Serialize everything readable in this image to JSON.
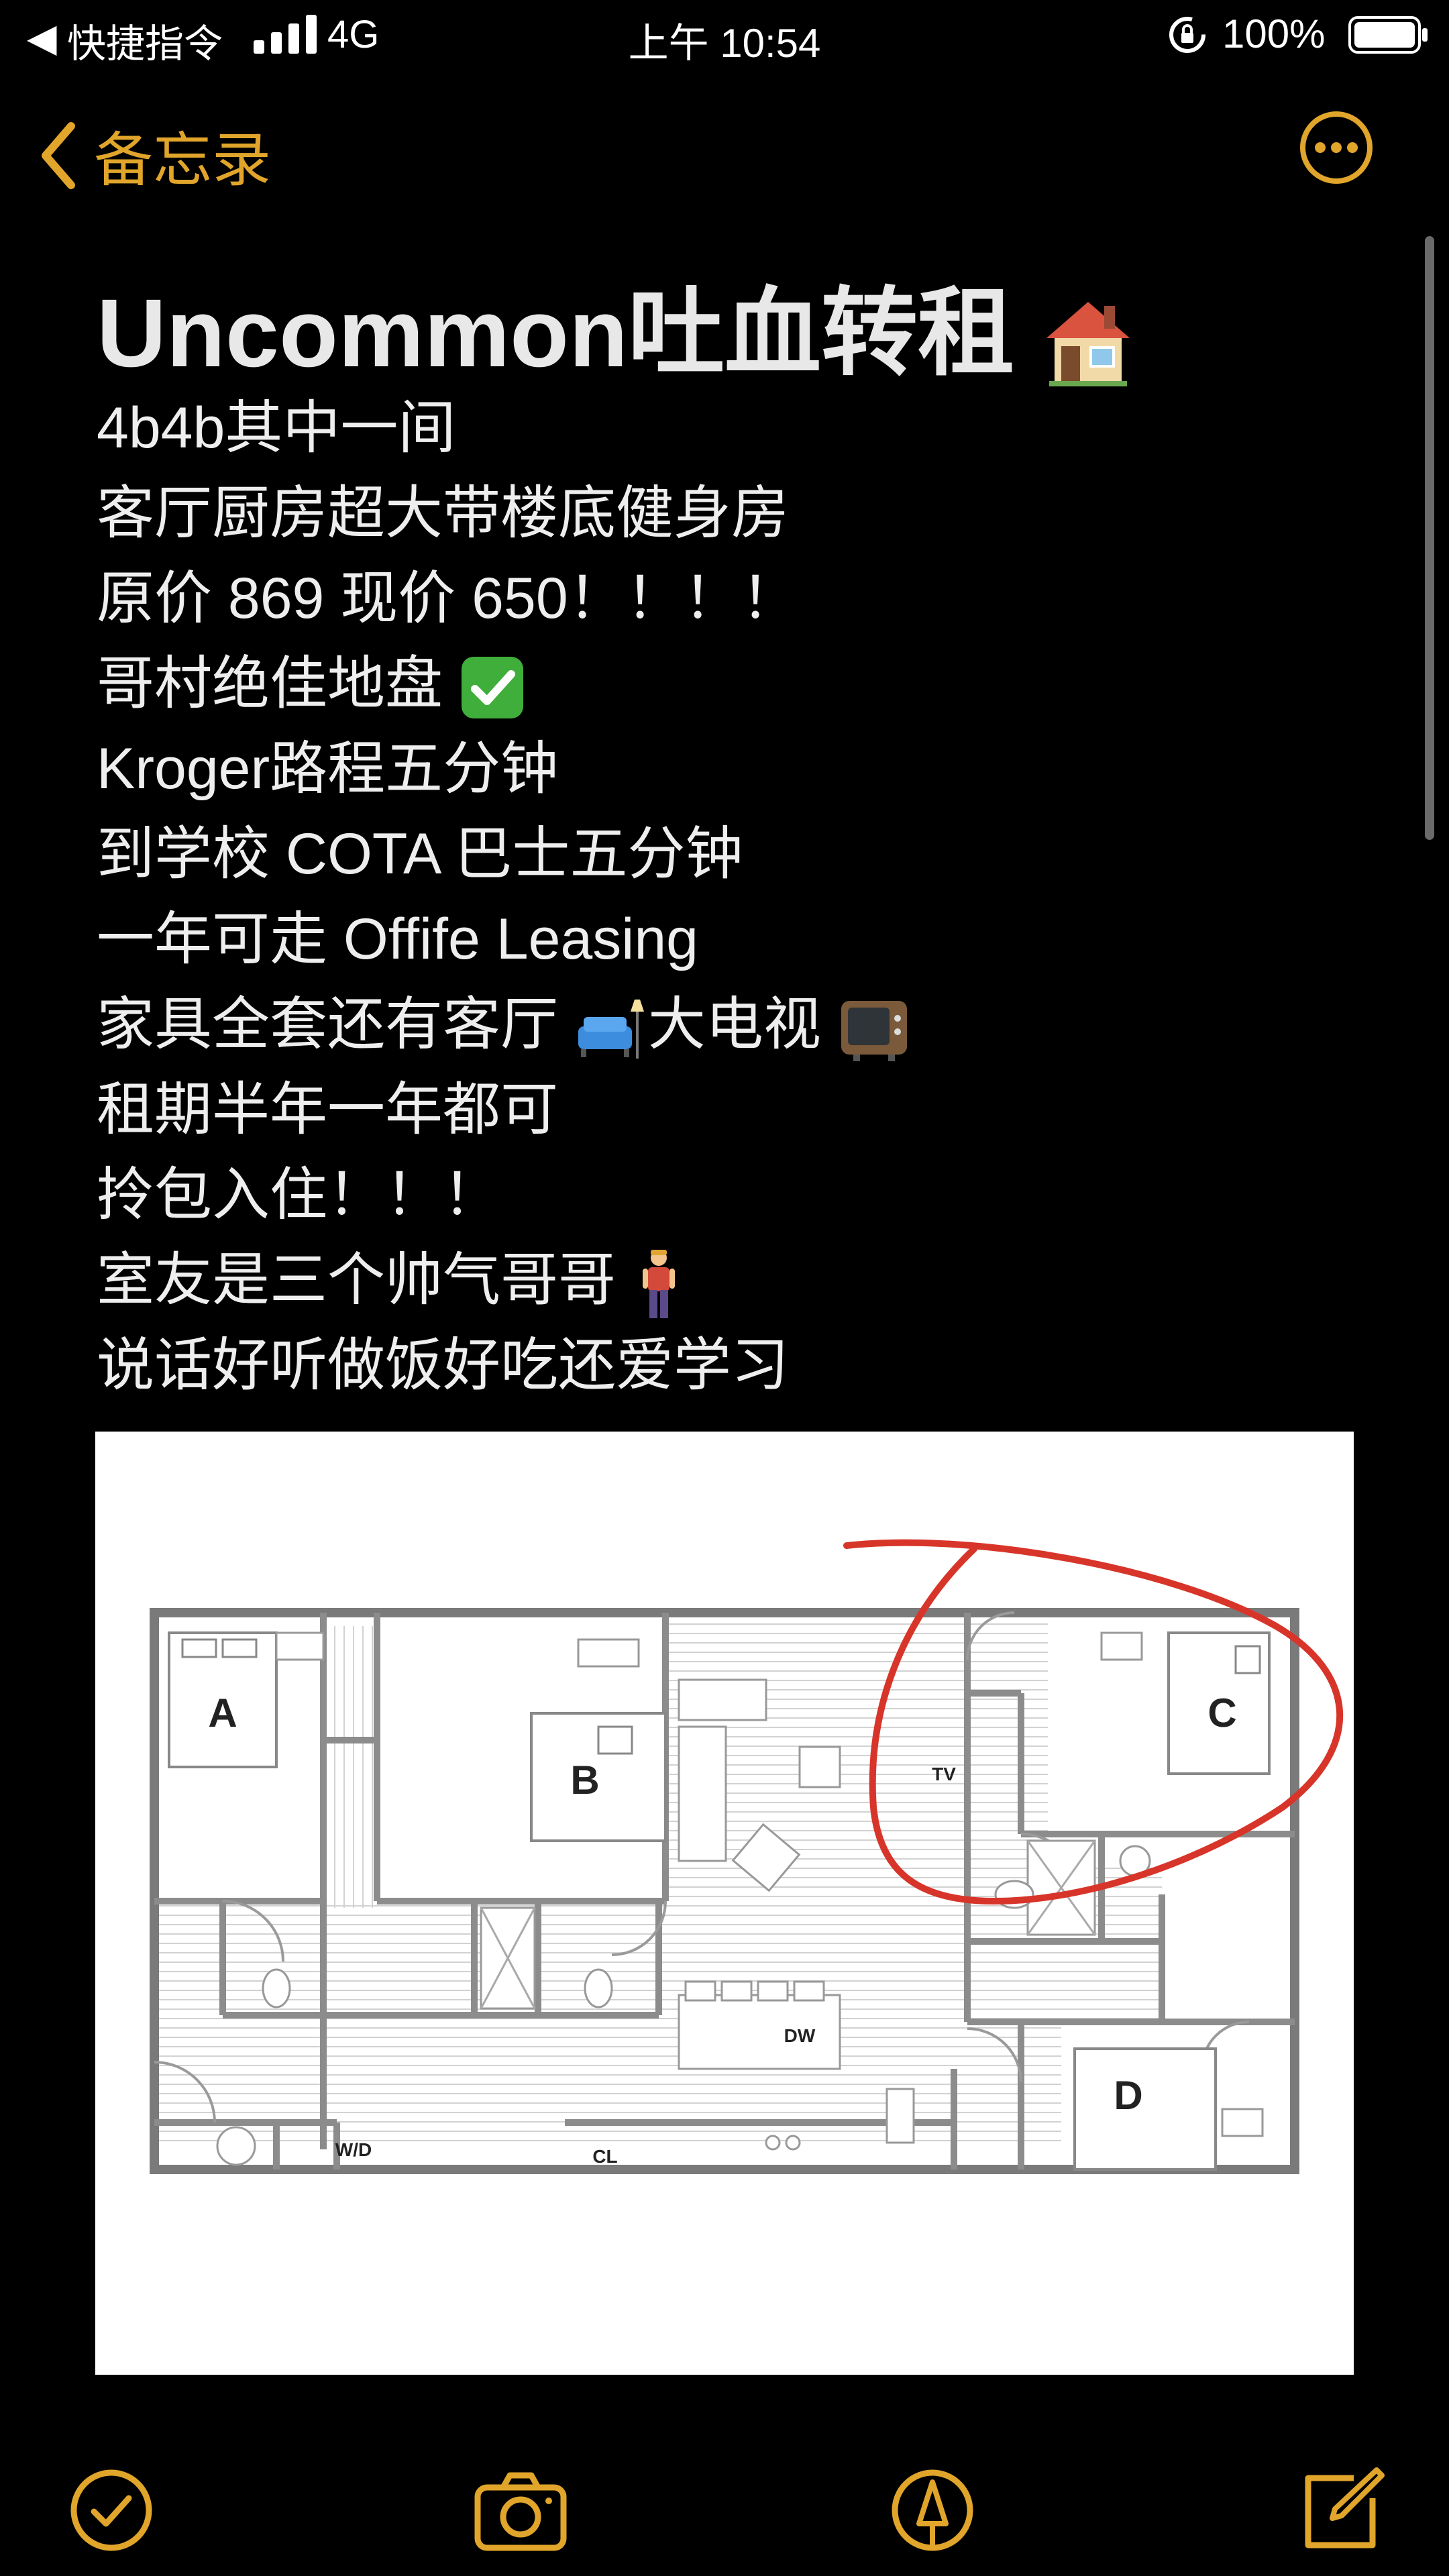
{
  "status": {
    "back_app": "快捷指令",
    "network": "4G",
    "time": "上午 10:54",
    "battery": "100%"
  },
  "nav": {
    "back_label": "备忘录",
    "more_icon": "ellipsis-circle-icon"
  },
  "note": {
    "title": "Uncommon吐血转租",
    "lines": [
      "4b4b其中一间",
      "客厅厨房超大带楼底健身房",
      "原价 869 现价 650！！！！",
      "哥村绝佳地盘",
      "Kroger路程五分钟",
      "到学校 COTA 巴士五分钟",
      "一年可走 Offife Leasing",
      "家具全套还有客厅",
      "大电视",
      "租期半年一年都可",
      "拎包入住！！！",
      "室友是三个帅气哥哥",
      "说话好听做饭好吃还爱学习"
    ]
  },
  "floor_plan": {
    "room_labels": [
      "A",
      "B",
      "C",
      "D"
    ],
    "fixture_labels": [
      "TV",
      "DW",
      "W/D",
      "CL"
    ],
    "highlight_color": "#d8352a"
  },
  "toolbar": {
    "icons": [
      "checklist-icon",
      "camera-icon",
      "markup-pen-icon",
      "compose-icon"
    ],
    "accent": "#e0a52a"
  }
}
